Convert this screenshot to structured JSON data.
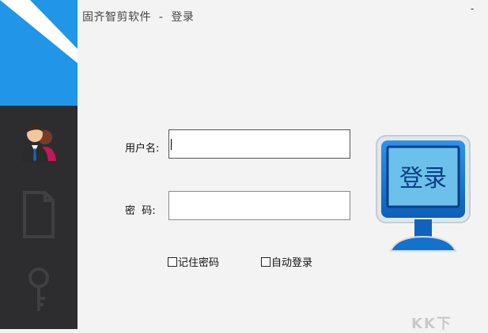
{
  "window": {
    "title": "固齐智剪软件  -  登录",
    "minimize_label": "-"
  },
  "sidebar": {
    "accent_color": "#2196e8",
    "background_color": "#2d2d30",
    "items": [
      {
        "icon": "users-icon"
      },
      {
        "icon": "file-icon"
      },
      {
        "icon": "key-icon"
      }
    ]
  },
  "form": {
    "username_label": "用户名:",
    "username_value": "",
    "password_label": "密  码:",
    "password_value": "",
    "remember_label": "记住密码",
    "auto_login_label": "自动登录"
  },
  "login_button": {
    "label": "登录",
    "color": "#1f7fd8"
  },
  "watermark": "KK下"
}
